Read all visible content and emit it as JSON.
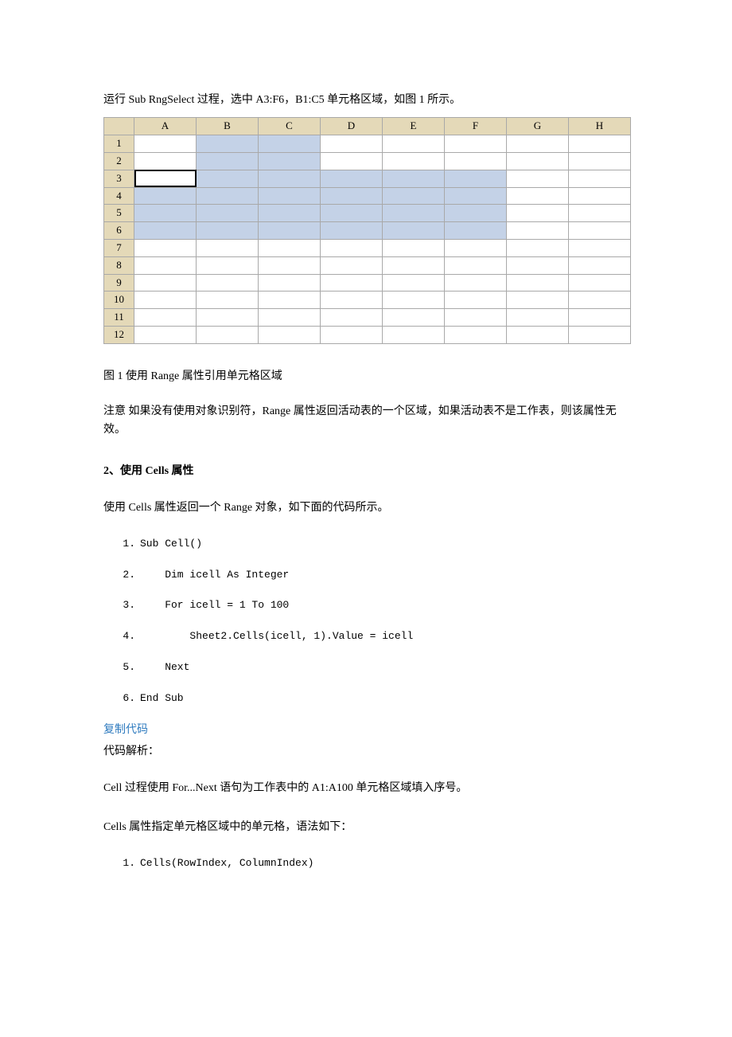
{
  "intro": "运行 Sub RngSelect 过程，选中 A3:F6，B1:C5 单元格区域，如图 1 所示。",
  "sheet": {
    "columns": [
      "A",
      "B",
      "C",
      "D",
      "E",
      "F",
      "G",
      "H"
    ],
    "rows": [
      "1",
      "2",
      "3",
      "4",
      "5",
      "6",
      "7",
      "8",
      "9",
      "10",
      "11",
      "12"
    ]
  },
  "caption": "图 1 使用 Range 属性引用单元格区域",
  "note": "注意 如果没有使用对象识别符，Range 属性返回活动表的一个区域，如果活动表不是工作表，则该属性无效。",
  "heading2": "2、使用 Cells 属性",
  "desc2": "使用 Cells 属性返回一个 Range 对象，如下面的代码所示。",
  "code1": {
    "lines": [
      {
        "n": "1.",
        "c": "Sub Cell()"
      },
      {
        "n": "2.",
        "c": "    Dim icell As Integer"
      },
      {
        "n": "3.",
        "c": "    For icell = 1 To 100"
      },
      {
        "n": "4.",
        "c": "        Sheet2.Cells(icell, 1).Value = icell"
      },
      {
        "n": "5.",
        "c": "    Next"
      },
      {
        "n": "6.",
        "c": "End Sub"
      }
    ]
  },
  "copy_label": "复制代码",
  "analysis_label": "代码解析：",
  "analysis_text": "Cell 过程使用 For...Next 语句为工作表中的 A1:A100 单元格区域填入序号。",
  "syntax_text": "Cells 属性指定单元格区域中的单元格，语法如下：",
  "code2": {
    "lines": [
      {
        "n": "1.",
        "c": "Cells(RowIndex, ColumnIndex)"
      }
    ]
  }
}
